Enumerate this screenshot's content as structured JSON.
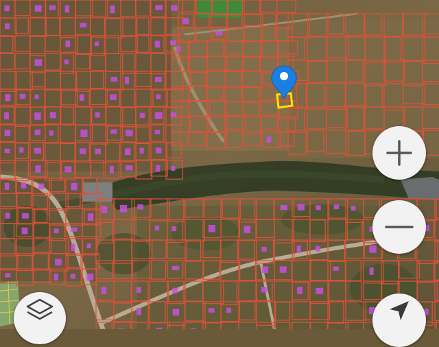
{
  "map": {
    "type": "satellite-cadastral",
    "parcel_outline_color": "#e0523a",
    "building_highlight_color": "#c84fe0",
    "selected_parcel_color": "#ffe600",
    "marker_color": "#1a7fe0",
    "green_zone_color": "#8fd18a"
  },
  "controls": {
    "zoom_in_icon": "plus-icon",
    "zoom_out_icon": "minus-icon",
    "layers_icon": "layers-icon",
    "locate_icon": "navigation-arrow-icon"
  }
}
